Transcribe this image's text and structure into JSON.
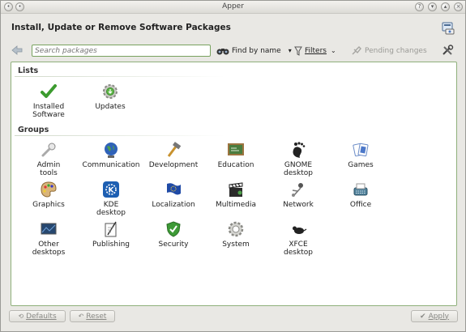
{
  "window": {
    "title": "Apper"
  },
  "header": {
    "title": "Install, Update or Remove Software Packages"
  },
  "toolbar": {
    "search_placeholder": "Search packages",
    "find_by_name": "Find by name",
    "filters": "Filters",
    "pending_changes": "Pending changes"
  },
  "lists": {
    "title": "Lists",
    "items": [
      {
        "label": "Installed\nSoftware",
        "icon": "checkmark-icon"
      },
      {
        "label": "Updates",
        "icon": "updates-gear-icon"
      }
    ]
  },
  "groups": {
    "title": "Groups",
    "items": [
      {
        "label": "Admin\ntools",
        "icon": "admin-tools-icon"
      },
      {
        "label": "Communication",
        "icon": "globe-icon"
      },
      {
        "label": "Development",
        "icon": "hammer-icon"
      },
      {
        "label": "Education",
        "icon": "chalkboard-icon"
      },
      {
        "label": "GNOME\ndesktop",
        "icon": "gnome-foot-icon"
      },
      {
        "label": "Games",
        "icon": "playing-cards-icon"
      },
      {
        "label": "Graphics",
        "icon": "palette-icon"
      },
      {
        "label": "KDE\ndesktop",
        "icon": "kde-icon"
      },
      {
        "label": "Localization",
        "icon": "flag-icon"
      },
      {
        "label": "Multimedia",
        "icon": "clapperboard-icon"
      },
      {
        "label": "Network",
        "icon": "network-icon"
      },
      {
        "label": "Office",
        "icon": "typewriter-icon"
      },
      {
        "label": "Other\ndesktops",
        "icon": "monitor-icon"
      },
      {
        "label": "Publishing",
        "icon": "quill-icon"
      },
      {
        "label": "Security",
        "icon": "shield-icon"
      },
      {
        "label": "System",
        "icon": "system-gear-icon"
      },
      {
        "label": "XFCE\ndesktop",
        "icon": "mouse-icon"
      }
    ]
  },
  "footer": {
    "defaults": "Defaults",
    "reset": "Reset",
    "apply": "Apply"
  },
  "colors": {
    "accent": "#78a25f",
    "check": "#3c9b2f"
  }
}
